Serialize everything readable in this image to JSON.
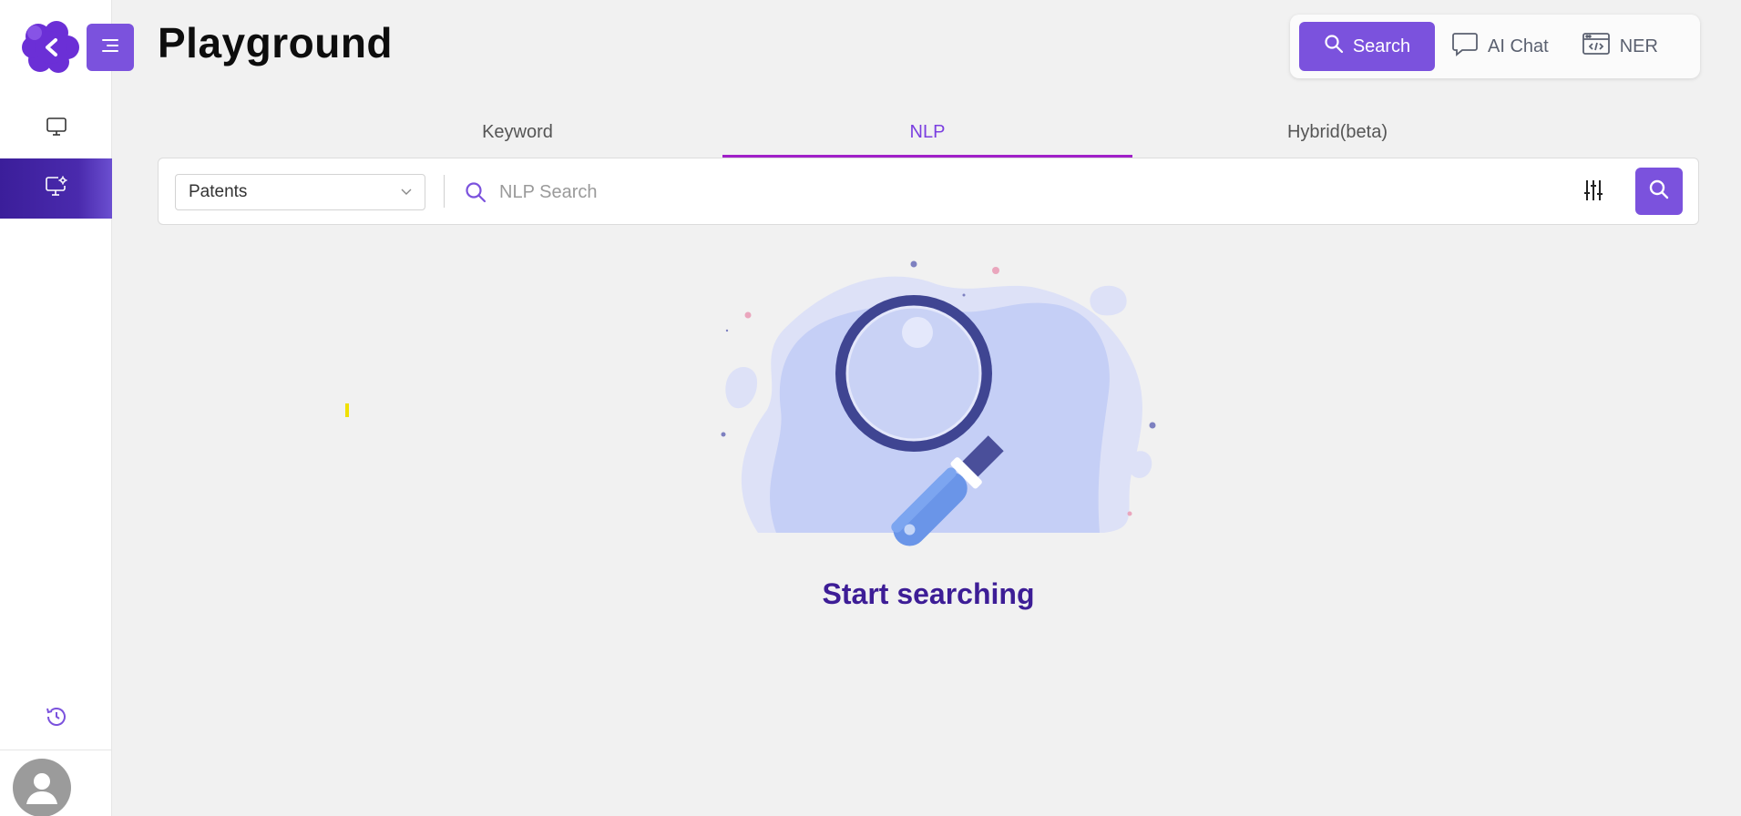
{
  "app": {
    "title": "Playground",
    "colors": {
      "accent": "#7b52dd",
      "sidebar_active": "#3b1e9a",
      "tab_active": "#7b3fe0",
      "empty_title": "#3d1d96"
    }
  },
  "sidebar": {
    "menu_icon": "menu-icon",
    "items": [
      {
        "name": "monitor",
        "icon": "monitor-icon",
        "active": false
      },
      {
        "name": "monitor-settings",
        "icon": "monitor-settings-icon",
        "active": true
      }
    ],
    "history_icon": "history-icon",
    "avatar_icon": "user-avatar-icon"
  },
  "mode_switch": {
    "items": [
      {
        "label": "Search",
        "icon": "search-icon",
        "active": true
      },
      {
        "label": "AI Chat",
        "icon": "chat-icon",
        "active": false
      },
      {
        "label": "NER",
        "icon": "code-window-icon",
        "active": false
      }
    ]
  },
  "tabs": [
    {
      "label": "Keyword",
      "active": false
    },
    {
      "label": "NLP",
      "active": true
    },
    {
      "label": "Hybrid(beta)",
      "active": false
    }
  ],
  "search": {
    "dataset_selected": "Patents",
    "placeholder": "NLP Search",
    "value": ""
  },
  "empty_state": {
    "title": "Start searching",
    "illustration": "magnifying-glass-illustration"
  }
}
